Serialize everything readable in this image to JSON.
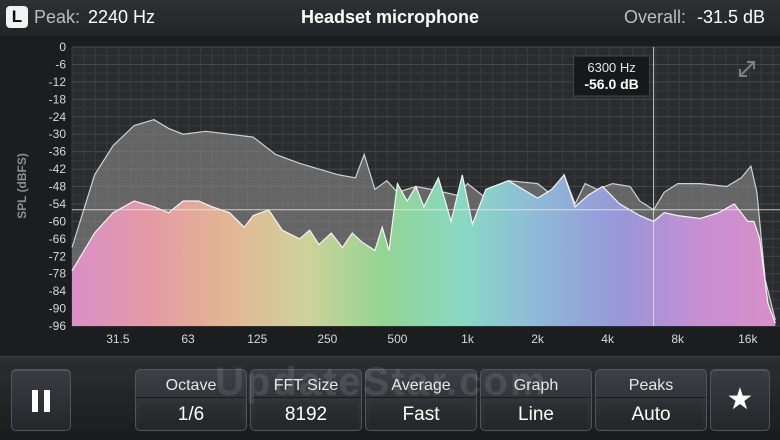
{
  "header": {
    "channel": "L",
    "peak_label": "Peak:",
    "peak_value": "2240 Hz",
    "title": "Headset microphone",
    "overall_label": "Overall:",
    "overall_value": "-31.5 dB"
  },
  "cursor": {
    "freq": "6300 Hz",
    "level": "-56.0 dB"
  },
  "watermark": "UpdateStar.com",
  "controls": [
    {
      "label": "Octave",
      "value": "1/6"
    },
    {
      "label": "FFT Size",
      "value": "8192"
    },
    {
      "label": "Average",
      "value": "Fast"
    },
    {
      "label": "Graph",
      "value": "Line"
    },
    {
      "label": "Peaks",
      "value": "Auto"
    }
  ],
  "icons": [
    "pause-icon",
    "star-icon",
    "expand-icon"
  ],
  "chart_data": {
    "type": "area",
    "ylabel": "SPL (dBFS)",
    "y_ticks": [
      0,
      -6,
      -12,
      -18,
      -24,
      -30,
      -36,
      -42,
      -48,
      -54,
      -60,
      -66,
      -72,
      -78,
      -84,
      -90,
      -96
    ],
    "x_tick_labels": [
      "31.5",
      "63",
      "125",
      "250",
      "500",
      "1k",
      "2k",
      "4k",
      "8k",
      "16k"
    ],
    "x_tick_freqs": [
      31.5,
      63,
      125,
      250,
      500,
      1000,
      2000,
      4000,
      8000,
      16000
    ],
    "x_range_hz": [
      20,
      22000
    ],
    "ylim": [
      -96,
      0
    ],
    "grid": true,
    "series": [
      {
        "role": "peak_hold",
        "color": "#9a9a9a",
        "points": [
          [
            20,
            -69
          ],
          [
            25,
            -44
          ],
          [
            30,
            -34
          ],
          [
            37,
            -27
          ],
          [
            45,
            -25
          ],
          [
            52,
            -28
          ],
          [
            60,
            -30
          ],
          [
            75,
            -29
          ],
          [
            95,
            -30
          ],
          [
            120,
            -31
          ],
          [
            150,
            -37
          ],
          [
            190,
            -40
          ],
          [
            230,
            -42
          ],
          [
            280,
            -44
          ],
          [
            330,
            -45
          ],
          [
            360,
            -37
          ],
          [
            400,
            -49
          ],
          [
            450,
            -46
          ],
          [
            500,
            -50
          ],
          [
            600,
            -48
          ],
          [
            700,
            -49
          ],
          [
            900,
            -51
          ],
          [
            1000,
            -47
          ],
          [
            1200,
            -52
          ],
          [
            1500,
            -46
          ],
          [
            2000,
            -47
          ],
          [
            2400,
            -52
          ],
          [
            2600,
            -44
          ],
          [
            2900,
            -54
          ],
          [
            3200,
            -47
          ],
          [
            3600,
            -49
          ],
          [
            4200,
            -47
          ],
          [
            5000,
            -48
          ],
          [
            5500,
            -53
          ],
          [
            6300,
            -56
          ],
          [
            7000,
            -50
          ],
          [
            8000,
            -47
          ],
          [
            10000,
            -47
          ],
          [
            13000,
            -48
          ],
          [
            15000,
            -45
          ],
          [
            16500,
            -41
          ],
          [
            17500,
            -50
          ],
          [
            19000,
            -80
          ],
          [
            21000,
            -94
          ]
        ]
      },
      {
        "role": "live",
        "gradient": [
          "#d98fc8",
          "#e49aa4",
          "#e3b694",
          "#cfd29a",
          "#94d493",
          "#88d9c4",
          "#8fb8d8",
          "#9797d8",
          "#c58fd3",
          "#d98fc8"
        ],
        "points": [
          [
            20,
            -77
          ],
          [
            25,
            -64
          ],
          [
            30,
            -57
          ],
          [
            37,
            -53
          ],
          [
            45,
            -55
          ],
          [
            52,
            -57
          ],
          [
            60,
            -53
          ],
          [
            70,
            -53
          ],
          [
            80,
            -55
          ],
          [
            95,
            -57
          ],
          [
            110,
            -62
          ],
          [
            120,
            -58
          ],
          [
            140,
            -56
          ],
          [
            160,
            -63
          ],
          [
            190,
            -66
          ],
          [
            210,
            -63
          ],
          [
            230,
            -68
          ],
          [
            260,
            -64
          ],
          [
            290,
            -69
          ],
          [
            320,
            -64
          ],
          [
            350,
            -67
          ],
          [
            400,
            -70
          ],
          [
            430,
            -62
          ],
          [
            460,
            -70
          ],
          [
            500,
            -47
          ],
          [
            550,
            -53
          ],
          [
            600,
            -48
          ],
          [
            650,
            -55
          ],
          [
            750,
            -45
          ],
          [
            850,
            -60
          ],
          [
            950,
            -44
          ],
          [
            1050,
            -61
          ],
          [
            1200,
            -49
          ],
          [
            1500,
            -46
          ],
          [
            2000,
            -52
          ],
          [
            2300,
            -49
          ],
          [
            2600,
            -44
          ],
          [
            2900,
            -55
          ],
          [
            3300,
            -51
          ],
          [
            3800,
            -48
          ],
          [
            4500,
            -54
          ],
          [
            5500,
            -58
          ],
          [
            6300,
            -60
          ],
          [
            7000,
            -57
          ],
          [
            8000,
            -58
          ],
          [
            10000,
            -59
          ],
          [
            12000,
            -57
          ],
          [
            14000,
            -54
          ],
          [
            16000,
            -60
          ],
          [
            17000,
            -60
          ],
          [
            18000,
            -66
          ],
          [
            19500,
            -88
          ],
          [
            21000,
            -95
          ]
        ]
      }
    ],
    "cursor_hz": 6300,
    "cursor_db": -56.0
  }
}
